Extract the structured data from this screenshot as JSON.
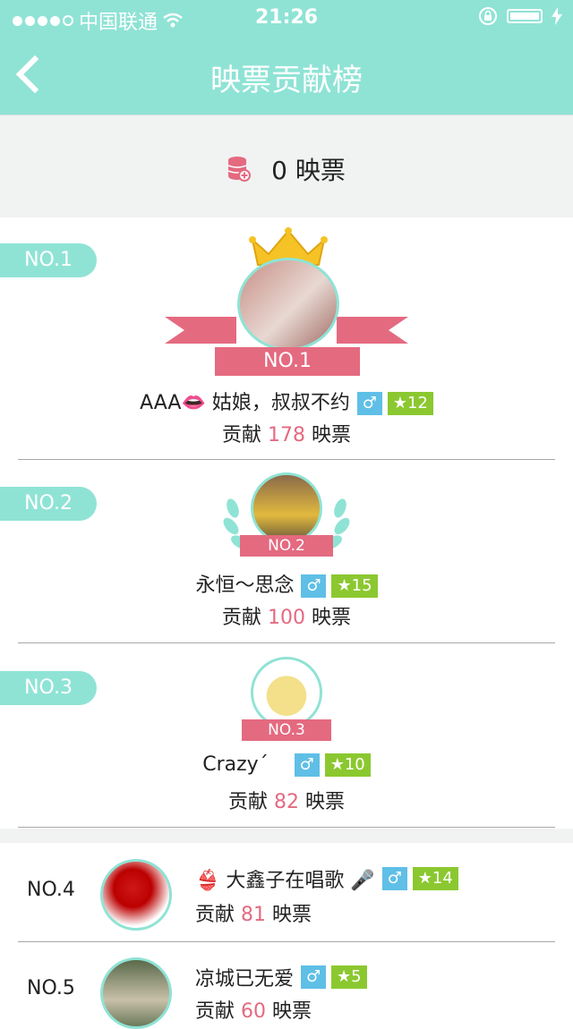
{
  "status": {
    "carrier": "中国联通",
    "time": "21:26"
  },
  "nav": {
    "title": "映票贡献榜"
  },
  "summary": {
    "count": "0",
    "unit": "映票"
  },
  "common": {
    "contrib_prefix": "贡献",
    "contrib_suffix": "映票",
    "gender": "♂",
    "star": "★"
  },
  "top": [
    {
      "rank": "NO.1",
      "ribbon": "NO.1",
      "name": "AAA👄 姑娘，叔叔不约",
      "level": "12",
      "votes": "178"
    },
    {
      "rank": "NO.2",
      "ribbon": "NO.2",
      "name": "永恒～思念",
      "level": "15",
      "votes": "100"
    },
    {
      "rank": "NO.3",
      "ribbon": "NO.3",
      "name": "Crazy´",
      "level": "10",
      "votes": "82"
    }
  ],
  "list": [
    {
      "rank": "NO.4",
      "name": "👙 大鑫子在唱歌 🎤",
      "level": "14",
      "votes": "81"
    },
    {
      "rank": "NO.5",
      "name": "凉城已无爱",
      "level": "5",
      "votes": "60"
    }
  ],
  "colors": {
    "accent": "#8fe3d5",
    "pink": "#e46a80",
    "gender": "#5fbfe6",
    "level": "#8bc830"
  }
}
